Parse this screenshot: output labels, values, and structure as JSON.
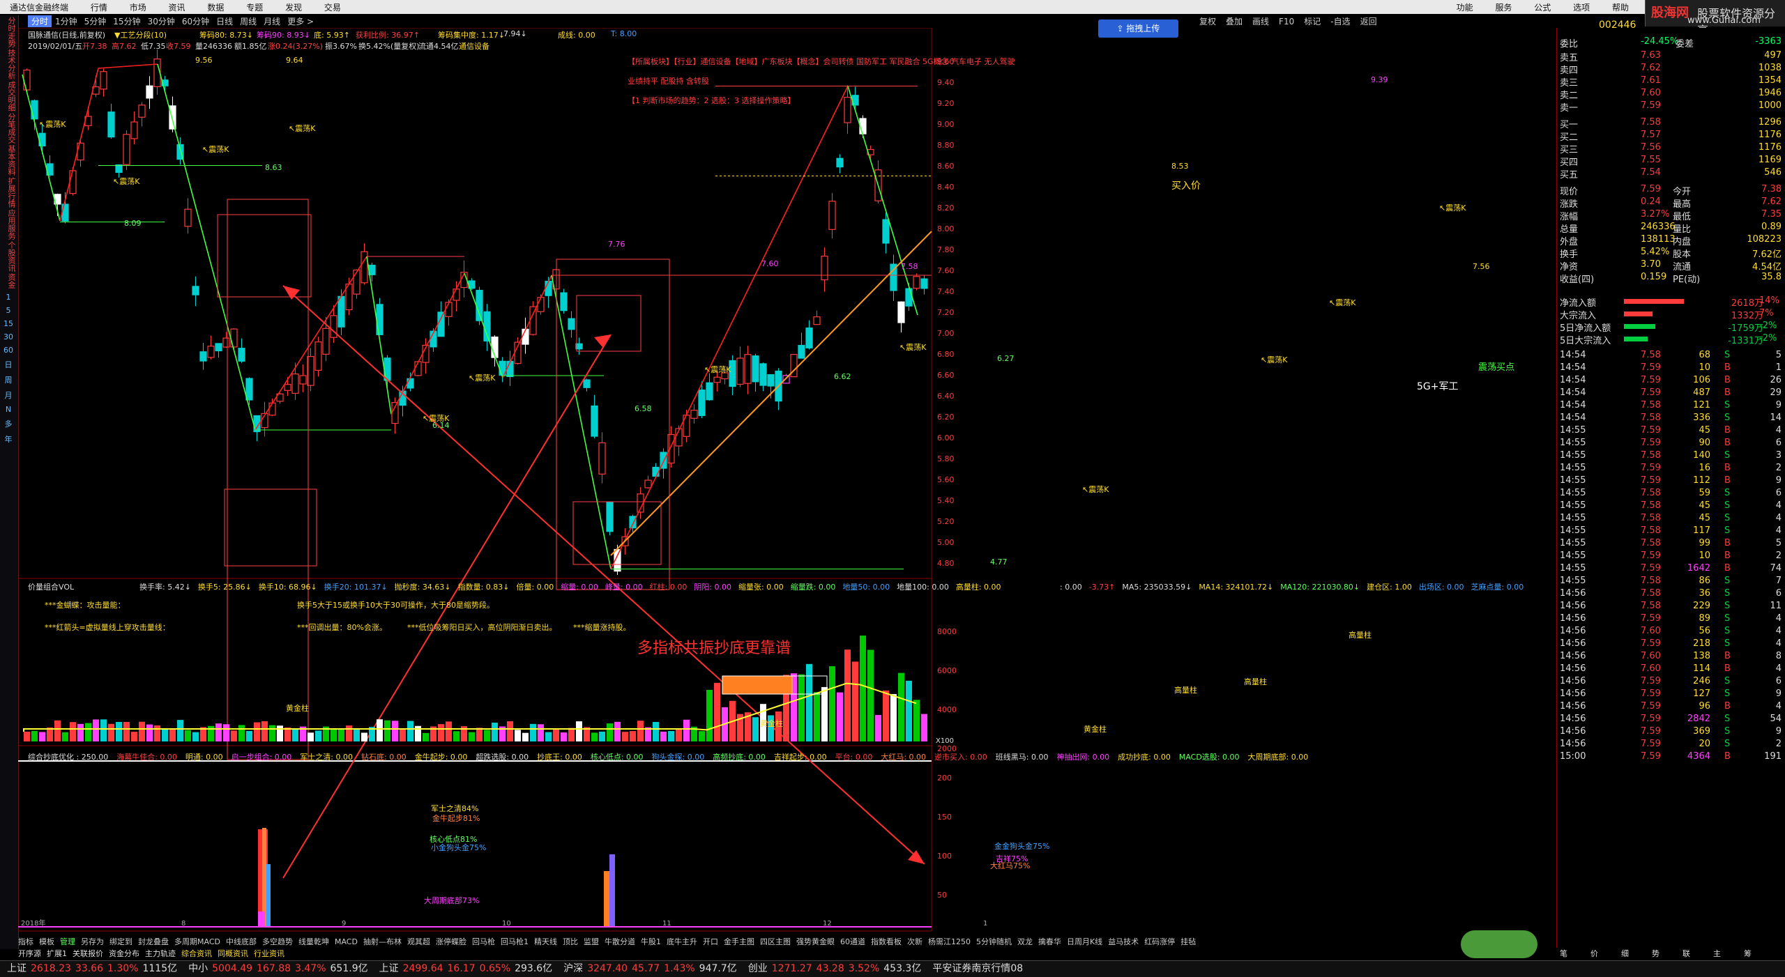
{
  "menu": [
    "通达信金融终端",
    "行情",
    "市场",
    "资讯",
    "数据",
    "专题",
    "发现",
    "交易"
  ],
  "menu_right": [
    "功能",
    "服务",
    "公式",
    "选项",
    "帮助"
  ],
  "logo": {
    "brand": "股海网",
    "slogan": "股票软件资源分享",
    "url": "www.Guhai.com"
  },
  "periods": [
    "分时",
    "1分钟",
    "5分钟",
    "15分钟",
    "30分钟",
    "60分钟",
    "日线",
    "周线",
    "月线",
    "更多 >"
  ],
  "period_selected": "分时",
  "right_toolbar": [
    "复权",
    "叠加",
    "画线",
    "F10",
    "标记",
    "-自选",
    "返回"
  ],
  "upload_button": "拖拽上传",
  "sidebar_tabs": [
    "分时走势",
    "技术分析",
    "成交明细",
    "分笔成交",
    "基本资料",
    "扩展行情",
    "应用服务",
    "个股资讯",
    "资金"
  ],
  "sidebar_nums": [
    "1",
    "5",
    "15",
    "30",
    "60",
    "日",
    "周",
    "月",
    "N",
    "多",
    "年"
  ],
  "header": {
    "stock": "国脉通信(日线,前复权)",
    "signal": "▼工艺分段(10)",
    "date_line": "2019/02/01/五",
    "open": "开7.38",
    "high": "高7.62",
    "low": "低7.35",
    "close": "收7.59",
    "volume": "量246336",
    "amount": "额1.85亿",
    "change": "涨0.24(3.27%)",
    "amplitude": "振3.67%",
    "turnover": "换5.42%(量复权)",
    "float": "流通4.54亿",
    "industry": "通信设备",
    "chip80": "筹码80: 8.73↓",
    "chip90": "筹码90: 8.93↓",
    "bottom": "底: 5.93↑",
    "profit_ratio": "获利比例: 36.97↑",
    "chip_conc": "筹码集中度: 1.17↓",
    "val_794": "7.94↓",
    "deal": "成线: 0.00",
    "tline": "T: 8.00"
  },
  "concepts": {
    "line1": "【所属板块】【行业】通信设备【地域】广东板块【概念】会司转债 国防军工 军民融合 5G概念 汽车电子 无人驾驶",
    "line2": "业绩持平 配股持 含转股",
    "line3": "【1 判断市场的趋势：2 选股：3 选择操作策略】"
  },
  "price_labels": [
    "9.56",
    "9.64",
    "8.09",
    "8.63",
    "7.76",
    "7.60",
    "7.58",
    "6.14",
    "6.58",
    "6.62",
    "6.27",
    "4.77",
    "9.39",
    "8.53",
    "7.56"
  ],
  "annotations": {
    "buy_price": "买入价",
    "tag_5g": "5G+军工",
    "buy_point": "震荡买点",
    "watermark": "多指标共振抄底更靠谱",
    "shock": "震荡K"
  },
  "right_axis": [
    "9.60",
    "9.40",
    "9.20",
    "9.00",
    "8.80",
    "8.60",
    "8.40",
    "8.20",
    "8.00",
    "7.80",
    "7.60",
    "7.40",
    "7.20",
    "7.00",
    "6.80",
    "6.60",
    "6.40",
    "6.20",
    "6.00",
    "5.80",
    "5.60",
    "5.40",
    "5.20",
    "5.00",
    "4.80"
  ],
  "vol_panel": {
    "title": "价量组合VOL",
    "row1": [
      "换手率: 5.42↓",
      "换手5: 25.86↓",
      "换手10: 68.96↓",
      "换手20: 101.37↓",
      "抛秒度: 34.63↓",
      "指数量: 0.83↓",
      "倍量: 0.00",
      "缩量: 0.00",
      "峰量: 0.00",
      "红柱: 0.00",
      "阴阳: 0.00",
      "缩量张: 0.00",
      "缩量跌: 0.00",
      "地量50: 0.00",
      "地量100: 0.00",
      "高量柱: 0.00"
    ],
    "row1b": [
      ": 0.00",
      "-3.73↑",
      "MA5: 235033.59↓",
      "MA14: 324101.72↓",
      "MA120: 221030.80↓",
      "建仓区: 1.00",
      "出场区: 0.00",
      "芝麻点量: 0.00"
    ],
    "lines": [
      "***金蝴蝶：攻击量能：",
      "换手5大于15或换手10大于30可操作，大于80是缩势段。",
      "***红箭头=虚拟量线上穿攻击量线：",
      "***回调出量：80%会涨。",
      "***低位吸筹阳日买入，高位阴阳渐日卖出。",
      "***缩量涨持股。"
    ],
    "tags": [
      "高量柱",
      "高量柱",
      "高量柱",
      "黄金柱",
      "黄金柱",
      "黄金柱"
    ],
    "axis": [
      "8000",
      "6000",
      "4000",
      "2000"
    ],
    "scale": "X100"
  },
  "bottom_panel": {
    "row": [
      "综合抄底优化 : 250.00",
      "海幕牛佳合: 0.00",
      "明通: 0.00",
      "启一步组合: 0.00",
      "军士之清: 0.00",
      "钻石底: 0.00",
      "金牛起步: 0.00",
      "超跌选股: 0.00",
      "抄底王: 0.00",
      "核心低点: 0.00",
      "狗头金探: 0.00",
      "高频抄底: 0.00",
      "吉祥起步: 0.00",
      "平台: 0.00",
      "大红马: 0.00",
      "逆市买入: 0.00",
      "班线黑马: 0.00",
      "神抽出网: 0.00",
      "成功抄底: 0.00",
      "MACD选股: 0.00",
      "大周期底部: 0.00"
    ],
    "labels_left": [
      "军士之清84%",
      "金牛起步81%",
      "核心低点81%",
      "小金狗头金75%",
      "大周期底部73%"
    ],
    "labels_right": [
      "金金狗头金75%",
      "吉祥75%",
      "大红马75%"
    ],
    "axis": [
      "200",
      "150",
      "100",
      "50"
    ]
  },
  "time_axis": [
    "2018年",
    "8",
    "9",
    "10",
    "11",
    "12",
    "1"
  ],
  "quotes": {
    "code": "002446",
    "ratio_label": "委比",
    "ratio_value": "-24.45%",
    "diff_label": "委差",
    "diff_value": "-3363",
    "asks": [
      [
        "卖五",
        "7.63",
        "497"
      ],
      [
        "卖四",
        "7.62",
        "1038"
      ],
      [
        "卖三",
        "7.61",
        "1354"
      ],
      [
        "卖二",
        "7.60",
        "1946"
      ],
      [
        "卖一",
        "7.59",
        "1000"
      ]
    ],
    "bids": [
      [
        "买一",
        "7.58",
        "1296"
      ],
      [
        "买二",
        "7.57",
        "1176"
      ],
      [
        "买三",
        "7.56",
        "1176"
      ],
      [
        "买四",
        "7.55",
        "1169"
      ],
      [
        "买五",
        "7.54",
        "546"
      ]
    ],
    "stats": [
      [
        "现价",
        "7.59",
        "今开",
        "7.38"
      ],
      [
        "涨跌",
        "0.24",
        "最高",
        "7.62"
      ],
      [
        "涨幅",
        "3.27%",
        "最低",
        "7.35"
      ],
      [
        "总量",
        "246336",
        "量比",
        "0.89"
      ],
      [
        "外盘",
        "138113",
        "内盘",
        "108223"
      ],
      [
        "换手",
        "5.42%",
        "股本",
        "7.62亿"
      ],
      [
        "净资",
        "3.70",
        "流通",
        "4.54亿"
      ],
      [
        "收益(四)",
        "0.159",
        "PE(动)",
        "35.8"
      ]
    ],
    "flows": [
      [
        "净流入额",
        "2618万",
        "14%"
      ],
      [
        "大宗流入",
        "1332万",
        "7%"
      ],
      [
        "5日净流入额",
        "-1759万",
        "-2%"
      ],
      [
        "5日大宗流入",
        "-1331万",
        "-2%"
      ]
    ]
  },
  "ticks": [
    [
      "14:54",
      "7.58",
      "68",
      "S",
      "5"
    ],
    [
      "14:54",
      "7.59",
      "10",
      "B",
      "1"
    ],
    [
      "14:54",
      "7.59",
      "106",
      "B",
      "26"
    ],
    [
      "14:54",
      "7.59",
      "487",
      "B",
      "29"
    ],
    [
      "14:54",
      "7.58",
      "121",
      "S",
      "9"
    ],
    [
      "14:54",
      "7.58",
      "336",
      "S",
      "14"
    ],
    [
      "14:55",
      "7.59",
      "45",
      "B",
      "4"
    ],
    [
      "14:55",
      "7.59",
      "90",
      "B",
      "6"
    ],
    [
      "14:55",
      "7.58",
      "140",
      "S",
      "3"
    ],
    [
      "14:55",
      "7.59",
      "16",
      "B",
      "2"
    ],
    [
      "14:55",
      "7.59",
      "112",
      "B",
      "9"
    ],
    [
      "14:55",
      "7.58",
      "59",
      "S",
      "6"
    ],
    [
      "14:55",
      "7.58",
      "45",
      "S",
      "4"
    ],
    [
      "14:55",
      "7.58",
      "45",
      "S",
      "4"
    ],
    [
      "14:55",
      "7.58",
      "117",
      "S",
      "4"
    ],
    [
      "14:55",
      "7.58",
      "99",
      "B",
      "5"
    ],
    [
      "14:55",
      "7.59",
      "10",
      "B",
      "2"
    ],
    [
      "14:55",
      "7.59",
      "1642",
      "B",
      "74"
    ],
    [
      "14:55",
      "7.58",
      "86",
      "S",
      "7"
    ],
    [
      "14:56",
      "7.58",
      "36",
      "S",
      "6"
    ],
    [
      "14:56",
      "7.58",
      "229",
      "S",
      "11"
    ],
    [
      "14:56",
      "7.59",
      "89",
      "S",
      "4"
    ],
    [
      "14:56",
      "7.60",
      "56",
      "S",
      "4"
    ],
    [
      "14:56",
      "7.59",
      "218",
      "S",
      "4"
    ],
    [
      "14:56",
      "7.60",
      "138",
      "B",
      "8"
    ],
    [
      "14:56",
      "7.60",
      "114",
      "B",
      "4"
    ],
    [
      "14:56",
      "7.59",
      "246",
      "S",
      "6"
    ],
    [
      "14:56",
      "7.59",
      "127",
      "S",
      "9"
    ],
    [
      "14:56",
      "7.59",
      "96",
      "B",
      "4"
    ],
    [
      "14:56",
      "7.59",
      "2842",
      "S",
      "54"
    ],
    [
      "14:56",
      "7.59",
      "369",
      "S",
      "9"
    ],
    [
      "14:56",
      "7.59",
      "20",
      "S",
      "2"
    ],
    [
      "15:00",
      "7.59",
      "4364",
      "B",
      "191"
    ]
  ],
  "rp_bottom_tabs": [
    "笔",
    "价",
    "细",
    "势",
    "联",
    "主",
    "筹"
  ],
  "bottom_tabs": [
    "指标",
    "模板",
    "管理",
    "另存为",
    "绑定到",
    "封龙叠盘",
    "多周期MACD",
    "中线底部",
    "多空趋势",
    "线量乾坤",
    "MACD",
    "抽射—布林",
    "观其超",
    "涨停蝶脸",
    "回马枪",
    "回马枪1",
    "精天线",
    "顶比",
    "监盟",
    "牛散分道",
    "牛股1",
    "底牛主升",
    "开口",
    "金手主图",
    "四区主图",
    "强势黄金眼",
    "60通道",
    "指数看板",
    "次新",
    "杨需江1250",
    "5分钟随机",
    "双龙",
    "擒春华",
    "日周月K线",
    "益马技术",
    "红码涨停",
    "挂毡"
  ],
  "bottom_tabs2": [
    "开序源",
    "扩展1",
    "关联报价",
    "资金分布",
    "主力轨迹",
    "综合资讯",
    "同概资讯",
    "行业资讯"
  ],
  "status": [
    {
      "t": "上证",
      "c": "#ddd"
    },
    {
      "t": "2618.23",
      "c": "#ff3b3b"
    },
    {
      "t": "33.66",
      "c": "#ff3b3b"
    },
    {
      "t": "1.30%",
      "c": "#ff3b3b"
    },
    {
      "t": "1115亿",
      "c": "#ddd"
    },
    {
      "t": "中小",
      "c": "#ddd"
    },
    {
      "t": "5004.49",
      "c": "#ff3b3b"
    },
    {
      "t": "167.88",
      "c": "#ff3b3b"
    },
    {
      "t": "3.47%",
      "c": "#ff3b3b"
    },
    {
      "t": "651.9亿",
      "c": "#ddd"
    },
    {
      "t": "上证",
      "c": "#ddd"
    },
    {
      "t": "2499.64",
      "c": "#ff3b3b"
    },
    {
      "t": "16.17",
      "c": "#ff3b3b"
    },
    {
      "t": "0.65%",
      "c": "#ff3b3b"
    },
    {
      "t": "293.6亿",
      "c": "#ddd"
    },
    {
      "t": "沪深",
      "c": "#ddd"
    },
    {
      "t": "3247.40",
      "c": "#ff3b3b"
    },
    {
      "t": "45.77",
      "c": "#ff3b3b"
    },
    {
      "t": "1.43%",
      "c": "#ff3b3b"
    },
    {
      "t": "947.7亿",
      "c": "#ddd"
    },
    {
      "t": "创业",
      "c": "#ddd"
    },
    {
      "t": "1271.27",
      "c": "#ff3b3b"
    },
    {
      "t": "43.28",
      "c": "#ff3b3b"
    },
    {
      "t": "3.52%",
      "c": "#ff3b3b"
    },
    {
      "t": "453.3亿",
      "c": "#ddd"
    },
    {
      "t": "平安证券南京行情08",
      "c": "#ddd"
    }
  ],
  "colors": {
    "up": "#ff3b3b",
    "down": "#00d0d0",
    "bg": "#000000",
    "grid": "#8b0000",
    "accent": "#ffff00"
  }
}
